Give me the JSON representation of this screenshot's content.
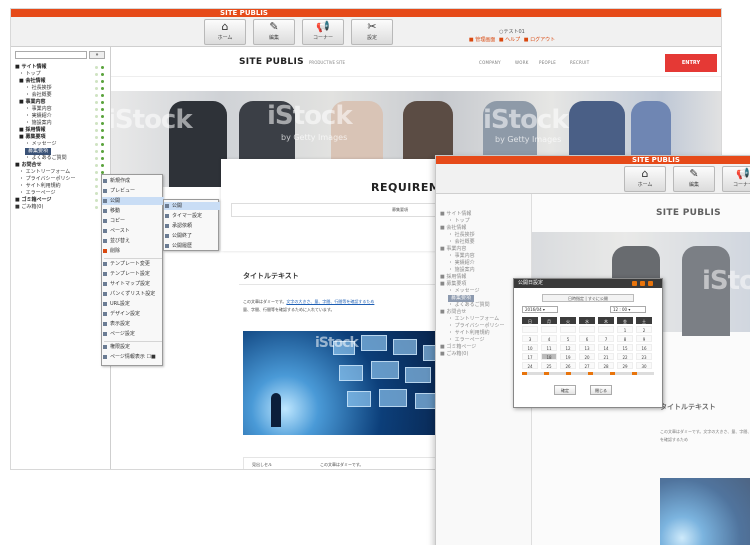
{
  "app": {
    "brand": "SITE PUBLIS",
    "toolbar": [
      {
        "icon": "home-icon",
        "glyph": "⌂",
        "label": "ホーム"
      },
      {
        "icon": "pencil-icon",
        "glyph": "✎",
        "label": "編集"
      },
      {
        "icon": "megaphone-icon",
        "glyph": "📢",
        "label": "コーナー"
      },
      {
        "icon": "tools-icon",
        "glyph": "✂",
        "label": "設定"
      }
    ],
    "user": {
      "name": "○テスト01",
      "links": [
        "■ 管理画面",
        "■ ヘルプ",
        "■ ログアウト"
      ]
    }
  },
  "tree": {
    "search_btn": "»",
    "items": [
      {
        "label": "■ サイト情報",
        "indent": 4,
        "style": "bold"
      },
      {
        "label": "・ トップ",
        "indent": 8
      },
      {
        "label": "■ 会社情報",
        "indent": 8,
        "style": "bold"
      },
      {
        "label": "・ 社長挨拶",
        "indent": 14
      },
      {
        "label": "・ 会社概要",
        "indent": 14
      },
      {
        "label": "■ 事業内容",
        "indent": 8,
        "style": "bold"
      },
      {
        "label": "・ 事業内容",
        "indent": 14
      },
      {
        "label": "・ 実績紹介",
        "indent": 14
      },
      {
        "label": "・ 施設案内",
        "indent": 14
      },
      {
        "label": "■ 採用情報",
        "indent": 8,
        "style": "bold"
      },
      {
        "label": "■ 募集要項",
        "indent": 8,
        "style": "bold"
      },
      {
        "label": "・ メッセージ",
        "indent": 14
      },
      {
        "label": "募集要項",
        "indent": 14,
        "style": "sel"
      },
      {
        "label": "・ よくあるご質問",
        "indent": 14
      },
      {
        "label": "■ お問合せ",
        "indent": 4,
        "style": "bold"
      },
      {
        "label": "・ エントリーフォーム",
        "indent": 8
      },
      {
        "label": "・ プライバシーポリシー",
        "indent": 8
      },
      {
        "label": "・ サイト利用規約",
        "indent": 8
      },
      {
        "label": "・ エラーページ",
        "indent": 8
      },
      {
        "label": "■ ゴミ箱ページ",
        "indent": 4,
        "style": "bold"
      },
      {
        "label": "■ ごみ箱(0)",
        "indent": 4
      }
    ]
  },
  "context_menu": {
    "items": [
      {
        "label": "新規作成",
        "hl": false
      },
      {
        "label": "プレビュー",
        "hl": false
      },
      {
        "label": "公開",
        "hl": true
      },
      {
        "label": "移動",
        "hl": false
      },
      {
        "label": "コピー",
        "hl": false
      },
      {
        "label": "ペースト",
        "hl": false
      },
      {
        "label": "並び替え",
        "hl": false
      },
      {
        "label": "削除",
        "hl": false,
        "red": true
      },
      {
        "label": "テンプレート変更",
        "hl": false
      },
      {
        "label": "テンプレート設定",
        "hl": false
      },
      {
        "label": "サイトマップ設定",
        "hl": false
      },
      {
        "label": "パンくずリスト設定",
        "hl": false
      },
      {
        "label": "URL設定",
        "hl": false
      },
      {
        "label": "デザイン設定",
        "hl": false
      },
      {
        "label": "表示設定",
        "hl": false
      },
      {
        "label": "ページ設定",
        "hl": false
      },
      {
        "label": "権限設定",
        "hl": false
      },
      {
        "label": "ページ情報表示 ☐■",
        "hl": false
      }
    ],
    "submenu": [
      {
        "label": "公開",
        "hl": true
      },
      {
        "label": "タイマー設定",
        "hl": false
      },
      {
        "label": "承認依頼",
        "hl": false
      },
      {
        "label": "公開終了",
        "hl": false
      },
      {
        "label": "公開履歴",
        "hl": false
      }
    ]
  },
  "site": {
    "logo": "SITE PUBLIS",
    "tagline": "PRODUCTIVE SITE",
    "nav": [
      "COMPANY",
      "WORK",
      "PEOPLE",
      "RECRUIT"
    ],
    "entry": "ENTRY",
    "hero_watermark": "iStock",
    "hero_watermark_sub": "by Getty Images",
    "requirements_title": "REQUIREME",
    "requirements_tab": "募集要項",
    "content_title": "タイトルテキスト",
    "content_text_prefix": "この文章はダミーです。",
    "content_text_link": "文字の大きさ、量、字間、行間等を確認するため",
    "content_text_line2": "量、字間、行間等を確認するために入れています。",
    "image_watermark": "iStock",
    "table_head": "見出しセル",
    "table_value": "この文章はダミーです。"
  },
  "secondary": {
    "brand": "SITE PUBLIS",
    "logo": "SITE PUBLIS",
    "content_title": "タイトルテキスト",
    "content_text": "この文章はダミーです。文字の大きさ、量、字間、行間等を確認するため",
    "hero_watermark": "iSto",
    "tree_items": [
      "■ サイト情報",
      "・ トップ",
      "■ 会社情報",
      "・ 社長挨拶",
      "・ 会社概要",
      "■ 事業内容",
      "・ 事業内容",
      "・ 実績紹介",
      "・ 施設案内",
      "■ 採用情報",
      "■ 募集要項",
      "・ メッセージ",
      "募集要項",
      "・ よくあるご質問",
      "■ お問合せ",
      "・ エントリーフォーム",
      "・ プライバシーポリシー",
      "・ サイト利用規約",
      "・ エラーページ",
      "■ ゴミ箱ページ",
      "■ ごみ箱(0)"
    ]
  },
  "calendar": {
    "title": "公開日設定",
    "tabs": "日時指定  |  すぐに公開",
    "select_left": "2016/04 ▾",
    "select_right": "12 : 00 ▾",
    "weekdays": [
      "日",
      "月",
      "火",
      "水",
      "木",
      "金",
      "土"
    ],
    "days": [
      "",
      "",
      "",
      "",
      "",
      "1",
      "2",
      "3",
      "4",
      "5",
      "6",
      "7",
      "8",
      "9",
      "10",
      "11",
      "12",
      "13",
      "14",
      "15",
      "16",
      "17",
      "18",
      "19",
      "20",
      "21",
      "22",
      "23",
      "24",
      "25",
      "26",
      "27",
      "28",
      "29",
      "30"
    ],
    "today_index": 22,
    "ok": "確定",
    "cancel": "閉じる"
  }
}
